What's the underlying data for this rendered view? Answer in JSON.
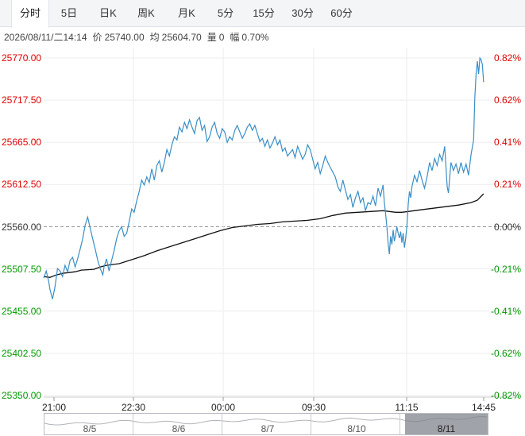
{
  "tabs": [
    {
      "label": "分时",
      "active": true
    },
    {
      "label": "5日",
      "active": false
    },
    {
      "label": "日K",
      "active": false
    },
    {
      "label": "周K",
      "active": false
    },
    {
      "label": "月K",
      "active": false
    },
    {
      "label": "5分",
      "active": false
    },
    {
      "label": "15分",
      "active": false
    },
    {
      "label": "30分",
      "active": false
    },
    {
      "label": "60分",
      "active": false
    }
  ],
  "info": {
    "datetime": "2026/08/11/二14:14",
    "price_label": "价",
    "price": "25740.00",
    "avg_label": "均",
    "avg": "25604.70",
    "volume_label": "量",
    "volume": "0",
    "change_label": "幅",
    "change": "0.70%"
  },
  "colors": {
    "price_line": "#3a8fc7",
    "avg_line": "#111111",
    "up": "#e00000",
    "down": "#009900",
    "flat": "#333333",
    "grid": "#eeeeee",
    "baseline": "#999999"
  },
  "chart_data": {
    "type": "line",
    "y_left_ticks": [
      "25770.00",
      "25717.50",
      "25665.00",
      "25612.50",
      "25560.00",
      "25507.50",
      "25455.00",
      "25402.50",
      "25350.00"
    ],
    "y_right_ticks": [
      "0.82%",
      "0.62%",
      "0.41%",
      "0.21%",
      "0.00%",
      "-0.21%",
      "-0.41%",
      "-0.62%",
      "-0.82%"
    ],
    "ylim": [
      25350,
      25770
    ],
    "x_ticks": [
      "21:00",
      "22:30",
      "00:00",
      "09:30",
      "11:15",
      "14:45"
    ],
    "baseline": 25560,
    "n_slots": 345,
    "price": [
      [
        0,
        25496
      ],
      [
        2,
        25505
      ],
      [
        4,
        25492
      ],
      [
        5,
        25482
      ],
      [
        7,
        25470
      ],
      [
        9,
        25485
      ],
      [
        11,
        25508
      ],
      [
        13,
        25505
      ],
      [
        15,
        25498
      ],
      [
        17,
        25512
      ],
      [
        19,
        25504
      ],
      [
        21,
        25518
      ],
      [
        23,
        25522
      ],
      [
        25,
        25510
      ],
      [
        27,
        25520
      ],
      [
        29,
        25532
      ],
      [
        31,
        25545
      ],
      [
        33,
        25562
      ],
      [
        35,
        25572
      ],
      [
        37,
        25558
      ],
      [
        39,
        25545
      ],
      [
        41,
        25532
      ],
      [
        43,
        25518
      ],
      [
        45,
        25508
      ],
      [
        47,
        25500
      ],
      [
        48,
        25510
      ],
      [
        50,
        25520
      ],
      [
        52,
        25505
      ],
      [
        54,
        25518
      ],
      [
        56,
        25530
      ],
      [
        58,
        25545
      ],
      [
        60,
        25555
      ],
      [
        62,
        25560
      ],
      [
        64,
        25548
      ],
      [
        66,
        25552
      ],
      [
        68,
        25566
      ],
      [
        70,
        25582
      ],
      [
        72,
        25578
      ],
      [
        74,
        25592
      ],
      [
        76,
        25604
      ],
      [
        78,
        25618
      ],
      [
        80,
        25612
      ],
      [
        82,
        25622
      ],
      [
        84,
        25615
      ],
      [
        86,
        25632
      ],
      [
        88,
        25618
      ],
      [
        90,
        25636
      ],
      [
        92,
        25642
      ],
      [
        94,
        25628
      ],
      [
        96,
        25640
      ],
      [
        98,
        25656
      ],
      [
        100,
        25648
      ],
      [
        102,
        25662
      ],
      [
        104,
        25672
      ],
      [
        106,
        25668
      ],
      [
        108,
        25684
      ],
      [
        110,
        25678
      ],
      [
        112,
        25690
      ],
      [
        114,
        25682
      ],
      [
        116,
        25693
      ],
      [
        118,
        25684
      ],
      [
        120,
        25676
      ],
      [
        122,
        25692
      ],
      [
        124,
        25696
      ],
      [
        126,
        25680
      ],
      [
        128,
        25686
      ],
      [
        130,
        25666
      ],
      [
        132,
        25672
      ],
      [
        134,
        25684
      ],
      [
        136,
        25690
      ],
      [
        138,
        25676
      ],
      [
        140,
        25670
      ],
      [
        142,
        25682
      ],
      [
        144,
        25678
      ],
      [
        146,
        25665
      ],
      [
        148,
        25672
      ],
      [
        150,
        25668
      ],
      [
        152,
        25680
      ],
      [
        154,
        25686
      ],
      [
        156,
        25678
      ],
      [
        158,
        25670
      ],
      [
        160,
        25676
      ],
      [
        162,
        25684
      ],
      [
        164,
        25688
      ],
      [
        166,
        25680
      ],
      [
        168,
        25686
      ],
      [
        170,
        25676
      ],
      [
        172,
        25666
      ],
      [
        174,
        25670
      ],
      [
        176,
        25660
      ],
      [
        178,
        25668
      ],
      [
        180,
        25658
      ],
      [
        182,
        25664
      ],
      [
        184,
        25672
      ],
      [
        186,
        25662
      ],
      [
        188,
        25668
      ],
      [
        190,
        25654
      ],
      [
        192,
        25658
      ],
      [
        194,
        25648
      ],
      [
        196,
        25652
      ],
      [
        198,
        25656
      ],
      [
        200,
        25646
      ],
      [
        202,
        25660
      ],
      [
        204,
        25652
      ],
      [
        206,
        25644
      ],
      [
        208,
        25650
      ],
      [
        210,
        25662
      ],
      [
        212,
        25656
      ],
      [
        214,
        25644
      ],
      [
        216,
        25632
      ],
      [
        218,
        25640
      ],
      [
        220,
        25626
      ],
      [
        222,
        25636
      ],
      [
        224,
        25648
      ],
      [
        226,
        25640
      ],
      [
        228,
        25634
      ],
      [
        230,
        25628
      ],
      [
        232,
        25622
      ],
      [
        234,
        25610
      ],
      [
        236,
        25604
      ],
      [
        238,
        25618
      ],
      [
        240,
        25606
      ],
      [
        242,
        25594
      ],
      [
        244,
        25600
      ],
      [
        246,
        25584
      ],
      [
        248,
        25596
      ],
      [
        250,
        25604
      ],
      [
        252,
        25590
      ],
      [
        254,
        25596
      ],
      [
        256,
        25580
      ],
      [
        258,
        25590
      ],
      [
        260,
        25588
      ],
      [
        262,
        25598
      ],
      [
        264,
        25586
      ],
      [
        266,
        25608
      ],
      [
        268,
        25598
      ],
      [
        270,
        25612
      ],
      [
        271,
        25590
      ],
      [
        272,
        25576
      ],
      [
        273,
        25560
      ],
      [
        274,
        25540
      ],
      [
        275,
        25526
      ],
      [
        276,
        25548
      ],
      [
        277,
        25538
      ],
      [
        278,
        25556
      ],
      [
        279,
        25542
      ],
      [
        280,
        25550
      ],
      [
        281,
        25560
      ],
      [
        282,
        25552
      ],
      [
        283,
        25546
      ],
      [
        284,
        25554
      ],
      [
        285,
        25540
      ],
      [
        286,
        25552
      ],
      [
        287,
        25534
      ],
      [
        288,
        25546
      ],
      [
        289,
        25562
      ],
      [
        290,
        25588
      ],
      [
        291,
        25604
      ],
      [
        292,
        25596
      ],
      [
        293,
        25610
      ],
      [
        295,
        25624
      ],
      [
        297,
        25616
      ],
      [
        299,
        25630
      ],
      [
        301,
        25618
      ],
      [
        303,
        25608
      ],
      [
        305,
        25622
      ],
      [
        307,
        25640
      ],
      [
        309,
        25630
      ],
      [
        311,
        25645
      ],
      [
        313,
        25636
      ],
      [
        315,
        25650
      ],
      [
        317,
        25642
      ],
      [
        319,
        25660
      ],
      [
        321,
        25610
      ],
      [
        322,
        25602
      ],
      [
        324,
        25640
      ],
      [
        326,
        25630
      ],
      [
        328,
        25638
      ],
      [
        330,
        25626
      ],
      [
        332,
        25640
      ],
      [
        334,
        25628
      ],
      [
        336,
        25638
      ],
      [
        338,
        25624
      ],
      [
        340,
        25650
      ],
      [
        342,
        25668
      ],
      [
        343,
        25720
      ],
      [
        344,
        25750
      ],
      [
        345,
        25766
      ],
      [
        346,
        25750
      ],
      [
        347,
        25770
      ],
      [
        348,
        25768
      ],
      [
        349,
        25762
      ],
      [
        350,
        25740
      ]
    ],
    "average": [
      [
        0,
        25498
      ],
      [
        5,
        25497
      ],
      [
        10,
        25500
      ],
      [
        15,
        25502
      ],
      [
        20,
        25503
      ],
      [
        25,
        25504
      ],
      [
        30,
        25506
      ],
      [
        40,
        25507
      ],
      [
        45,
        25510
      ],
      [
        50,
        25512
      ],
      [
        60,
        25514
      ],
      [
        70,
        25519
      ],
      [
        80,
        25524
      ],
      [
        90,
        25530
      ],
      [
        100,
        25535
      ],
      [
        110,
        25540
      ],
      [
        120,
        25545
      ],
      [
        130,
        25550
      ],
      [
        140,
        25555
      ],
      [
        150,
        25559
      ],
      [
        160,
        25561
      ],
      [
        170,
        25563
      ],
      [
        180,
        25564
      ],
      [
        190,
        25566
      ],
      [
        200,
        25567
      ],
      [
        210,
        25568
      ],
      [
        220,
        25570
      ],
      [
        230,
        25574
      ],
      [
        240,
        25577
      ],
      [
        250,
        25578
      ],
      [
        260,
        25579
      ],
      [
        270,
        25580
      ],
      [
        275,
        25579
      ],
      [
        280,
        25578
      ],
      [
        285,
        25578
      ],
      [
        290,
        25579
      ],
      [
        300,
        25581
      ],
      [
        310,
        25583
      ],
      [
        320,
        25585
      ],
      [
        330,
        25587
      ],
      [
        340,
        25590
      ],
      [
        345,
        25593
      ],
      [
        350,
        25601
      ]
    ]
  },
  "navigator": {
    "labels": [
      "8/5",
      "8/6",
      "8/7",
      "8/10",
      "8/11"
    ],
    "selected": "8/11"
  }
}
